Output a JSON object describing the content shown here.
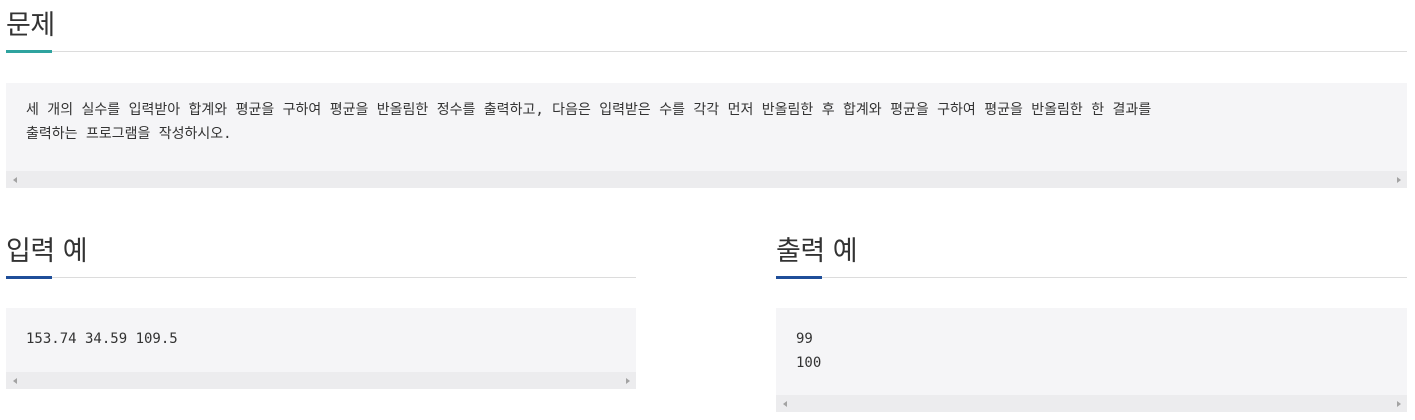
{
  "problem": {
    "title": "문제",
    "accent_color": "#2ea39f",
    "text": "세 개의 실수를 입력받아 합계와 평균을 구하여 평균을 반올림한 정수를 출력하고, 다음은 입력받은 수를 각각 먼저 반올림한 후 합계와 평균을 구하여 평균을 반올림한 한 결과를\n출력하는 프로그램을 작성하시오."
  },
  "input_example": {
    "title": "입력 예",
    "accent_color": "#1f4e99",
    "text": "153.74 34.59 109.5"
  },
  "output_example": {
    "title": "출력 예",
    "accent_color": "#1f4e99",
    "text": "99\n100"
  },
  "scrollbar": {
    "left_icon": "scroll-left-arrow-icon",
    "right_icon": "scroll-right-arrow-icon"
  }
}
